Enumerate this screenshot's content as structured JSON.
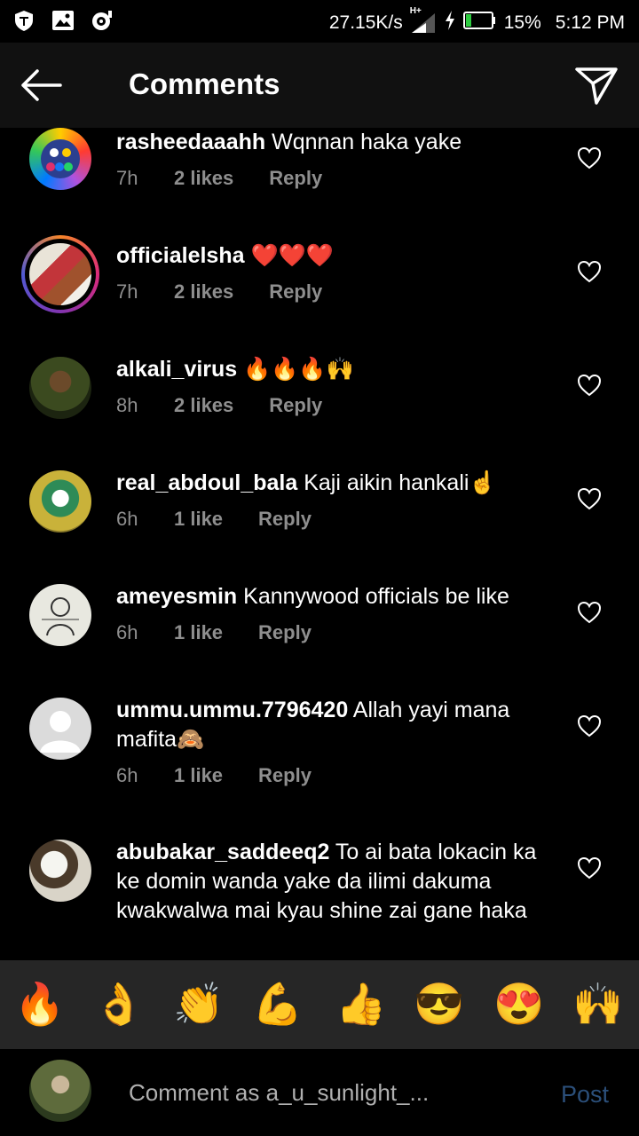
{
  "status_bar": {
    "net_speed": "27.15K/s",
    "network_type": "H+",
    "battery": "15%",
    "time": "5:12 PM",
    "icons": [
      "vpn-icon",
      "gallery-icon",
      "app-notification-icon",
      "signal-icon",
      "charging-icon",
      "battery-icon"
    ]
  },
  "header": {
    "title": "Comments",
    "back_icon": "arrow-left-icon",
    "share_icon": "paper-plane-icon"
  },
  "comments": [
    {
      "username": "rasheedaaahh",
      "text": "Wqnnan haka yake",
      "time": "7h",
      "likes": "2 likes",
      "reply": "Reply"
    },
    {
      "username": "officialelsha",
      "text": "❤️❤️❤️",
      "time": "7h",
      "likes": "2 likes",
      "reply": "Reply"
    },
    {
      "username": "alkali_virus",
      "text": "🔥🔥🔥🙌",
      "time": "8h",
      "likes": "2 likes",
      "reply": "Reply"
    },
    {
      "username": "real_abdoul_bala",
      "text": "Kaji aikin hankali☝️",
      "time": "6h",
      "likes": "1 like",
      "reply": "Reply"
    },
    {
      "username": "ameyesmin",
      "text": "Kannywood officials be like",
      "time": "6h",
      "likes": "1 like",
      "reply": "Reply"
    },
    {
      "username": "ummu.ummu.7796420",
      "text": "Allah yayi mana mafita🙈",
      "time": "6h",
      "likes": "1 like",
      "reply": "Reply"
    },
    {
      "username": "abubakar_saddeeq2",
      "text": "To ai bata lokacin ka ke domin wanda yake da ilimi dakuma kwakwalwa mai kyau shine zai gane haka",
      "time": "",
      "likes": "",
      "reply": ""
    }
  ],
  "emoji_bar": [
    "🔥",
    "👌",
    "👏",
    "💪",
    "👍",
    "😎",
    "😍",
    "🙌"
  ],
  "input": {
    "placeholder": "Comment as a_u_sunlight_...",
    "post_label": "Post"
  },
  "colors": {
    "background": "#000000",
    "header_bg": "#111111",
    "emoji_bar_bg": "#262626",
    "meta_text": "#8e8e8e",
    "post_disabled": "#2b4f7a"
  }
}
